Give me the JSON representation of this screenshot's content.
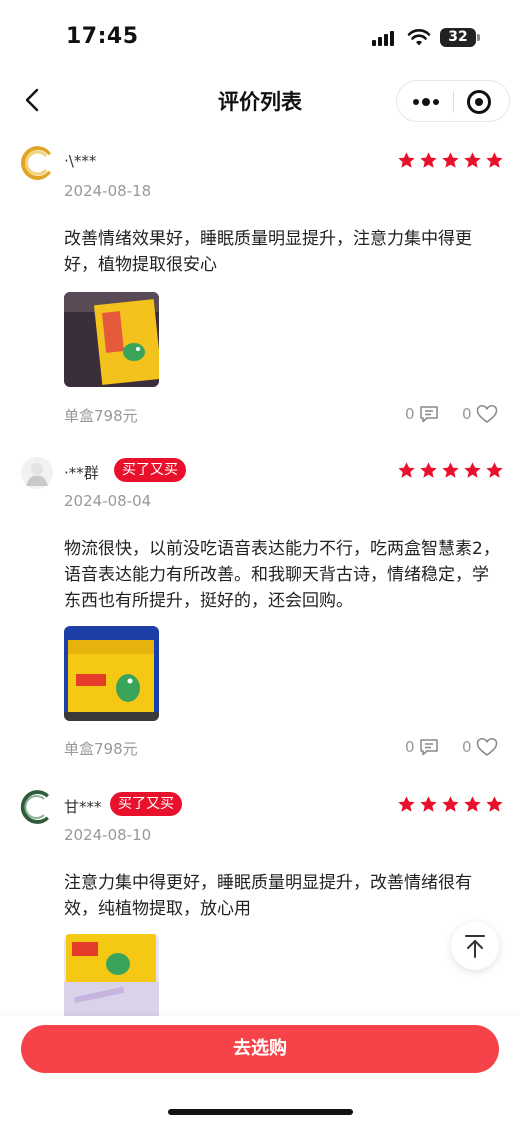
{
  "status_bar": {
    "time": "17:45",
    "battery": "32"
  },
  "nav": {
    "title": "评价列表"
  },
  "reviews": [
    {
      "username": "·\\***",
      "badge": "",
      "rating": 5,
      "date": "2024-08-18",
      "content": "改善情绪效果好，睡眠质量明显提升，注意力集中得更好，植物提取很安心",
      "price": "单盒798元",
      "comments": "0",
      "likes": "0"
    },
    {
      "username": "·**群",
      "badge": "买了又买",
      "rating": 5,
      "date": "2024-08-04",
      "content": "物流很快，以前没吃语音表达能力不行，吃两盒智慧素2，语音表达能力有所改善。和我聊天背古诗，情绪稳定，学东西也有所提升，挺好的，还会回购。",
      "price": "单盒798元",
      "comments": "0",
      "likes": "0"
    },
    {
      "username": "甘***",
      "badge": "买了又买",
      "rating": 5,
      "date": "2024-08-10",
      "content": "注意力集中得更好，睡眠质量明显提升，改善情绪很有效，纯植物提取，放心用",
      "price": "",
      "comments": "",
      "likes": ""
    }
  ],
  "bottom": {
    "buy_label": "去选购"
  },
  "colors": {
    "accent": "#e8102a",
    "button": "#f64349",
    "muted": "#999999"
  }
}
